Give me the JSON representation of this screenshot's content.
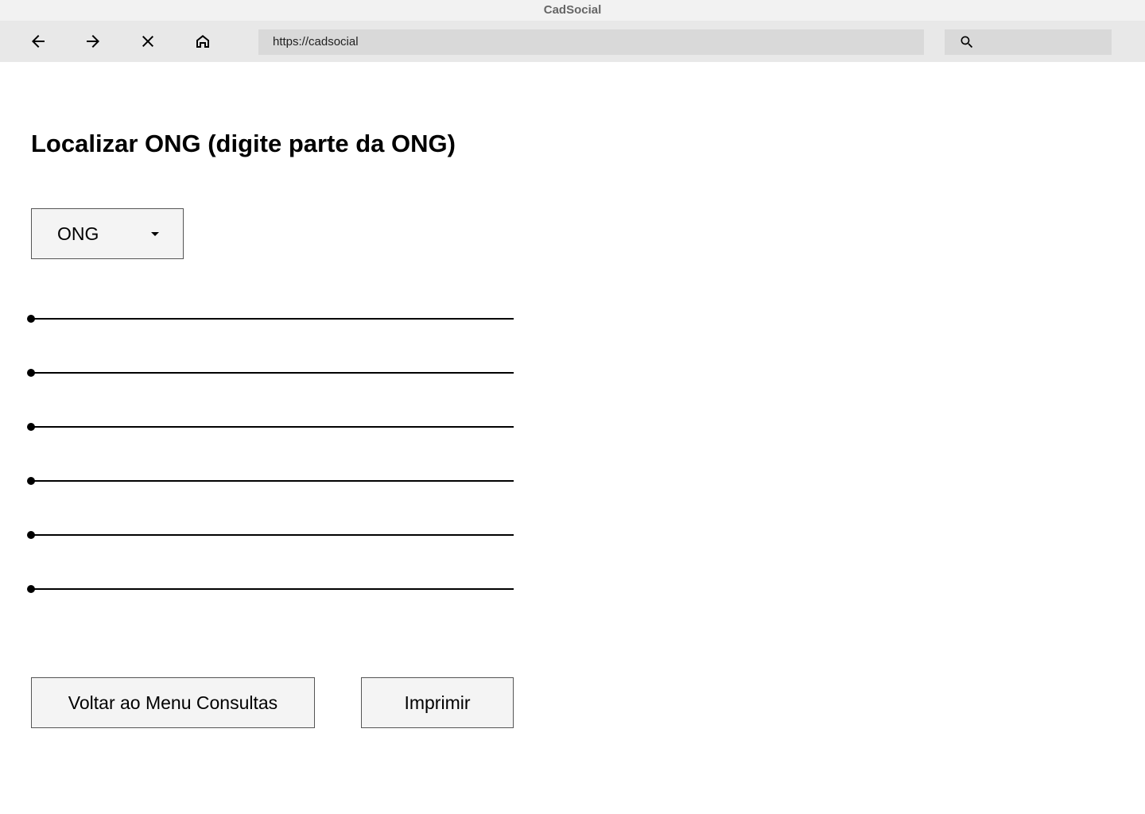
{
  "window": {
    "title": "CadSocial"
  },
  "toolbar": {
    "url": "https://cadsocial",
    "icons": [
      "arrow-left-icon",
      "arrow-right-icon",
      "close-icon",
      "home-icon",
      "search-icon"
    ]
  },
  "main": {
    "title": "Localizar ONG (digite parte da ONG)",
    "dropdown": {
      "selected": "ONG"
    },
    "result_rows": 6,
    "buttons": {
      "back_label": "Voltar ao Menu Consultas",
      "print_label": "Imprimir"
    }
  }
}
